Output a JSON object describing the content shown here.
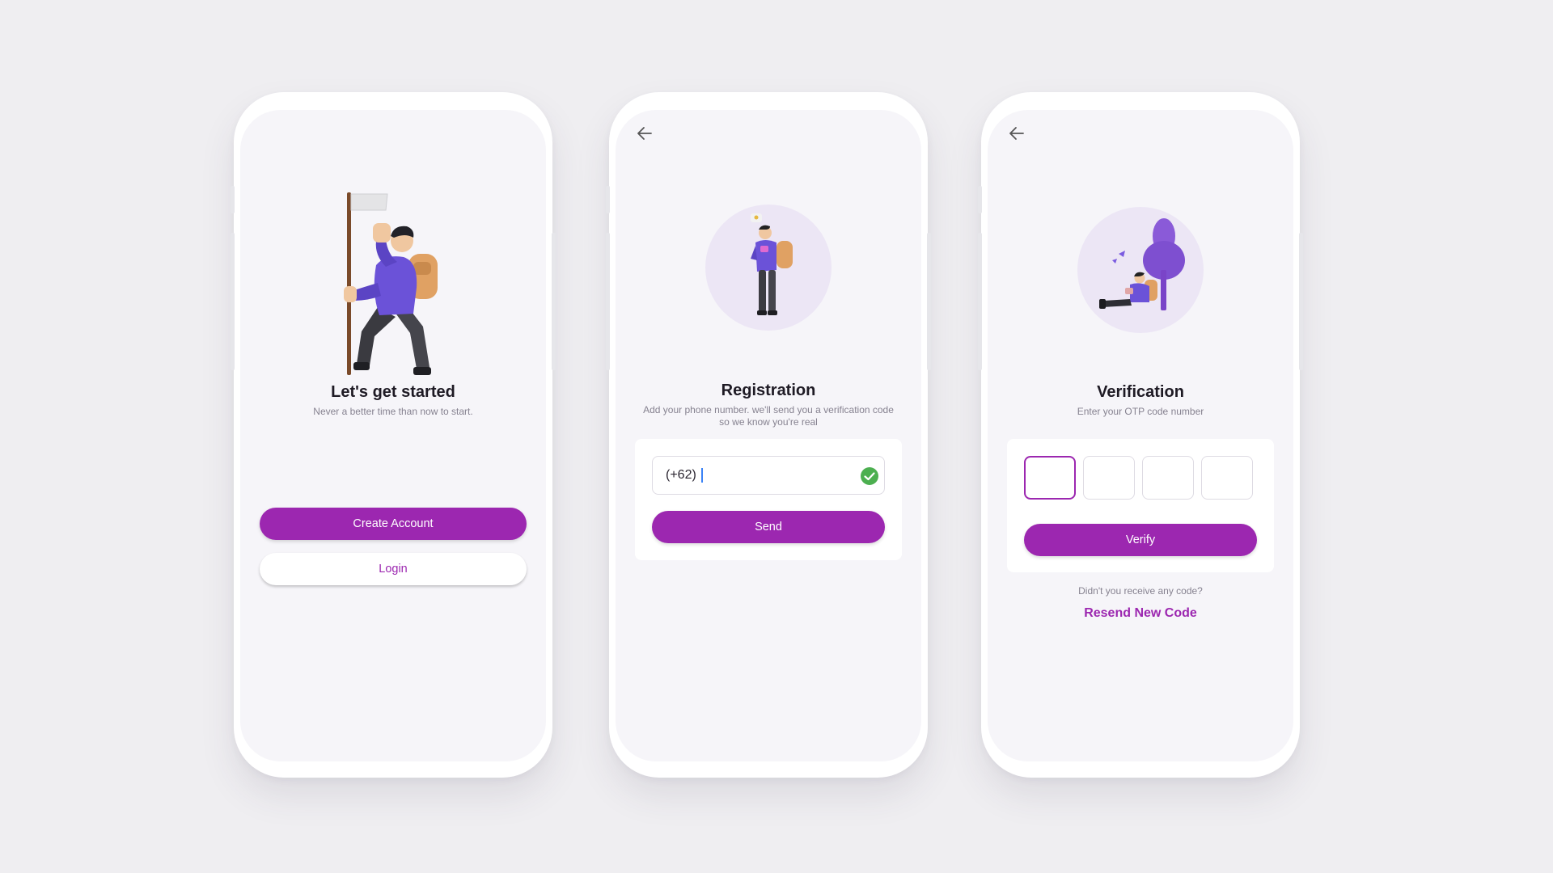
{
  "screens": {
    "welcome": {
      "title": "Let's get started",
      "subtitle": "Never a better time than now to start.",
      "create_account_label": "Create Account",
      "login_label": "Login"
    },
    "registration": {
      "title": "Registration",
      "subtitle_line1": "Add your phone number. we'll send you a verification code",
      "subtitle_line2": "so we know you're real",
      "phone_prefix": "(+62)",
      "send_label": "Send"
    },
    "verification": {
      "title": "Verification",
      "subtitle": "Enter your OTP code number",
      "verify_label": "Verify",
      "resend_prompt": "Didn't you receive any code?",
      "resend_label": "Resend New Code"
    }
  },
  "colors": {
    "background": "#efeef1",
    "screen": "#f6f5f9",
    "accent": "#9c27b0",
    "success": "#4caf50",
    "illustration_purple": "#7b5ce0"
  },
  "icons": [
    "back-arrow-icon",
    "check-circle-icon"
  ]
}
